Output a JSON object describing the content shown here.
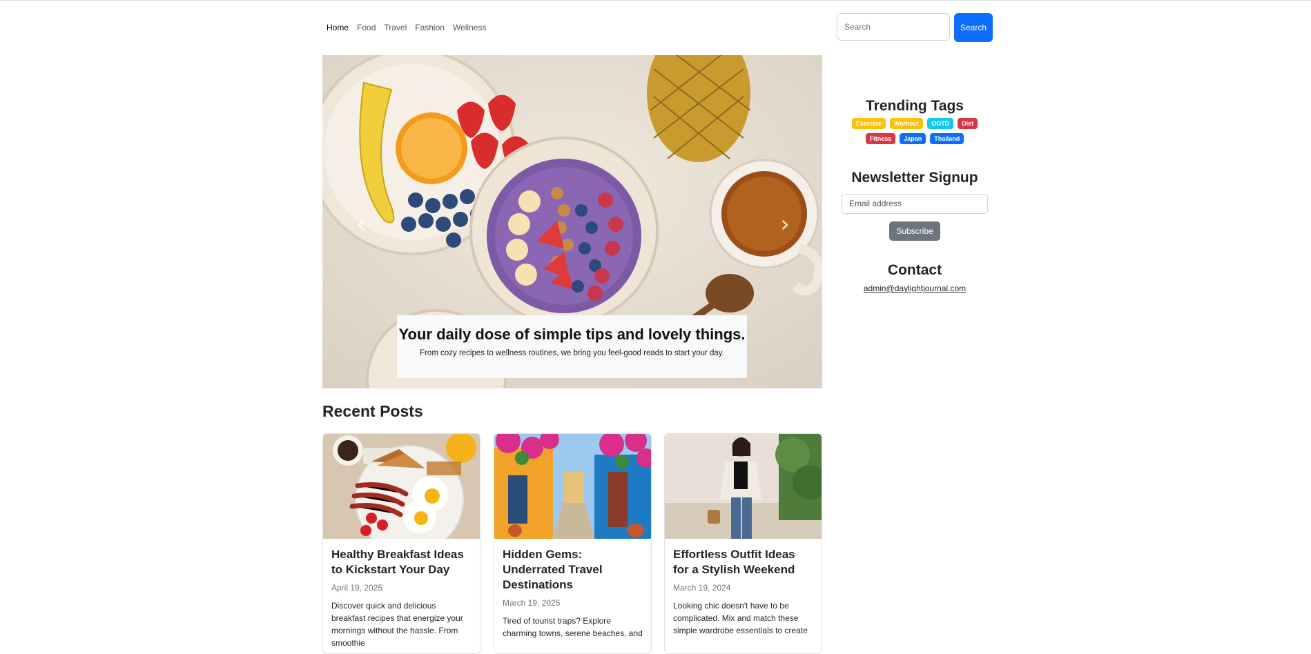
{
  "nav": {
    "links": [
      "Home",
      "Food",
      "Travel",
      "Fashion",
      "Wellness"
    ],
    "search_placeholder": "Search",
    "search_button": "Search"
  },
  "hero": {
    "title": "Your daily dose of simple tips and lovely things.",
    "subtitle": "From cozy recipes to wellness routines, we bring you feel-good reads to start your day."
  },
  "recent": {
    "heading": "Recent Posts",
    "posts": [
      {
        "title": "Healthy Breakfast Ideas to Kickstart Your Day",
        "date": "April 19, 2025",
        "excerpt": "Discover quick and delicious breakfast recipes that energize your mornings without the hassle. From smoothie"
      },
      {
        "title": "Hidden Gems: Underrated Travel Destinations",
        "date": "March 19, 2025",
        "excerpt": "Tired of tourist traps? Explore charming towns, serene beaches, and"
      },
      {
        "title": "Effortless Outfit Ideas for a Stylish Weekend",
        "date": "March 19, 2024",
        "excerpt": "Looking chic doesn't have to be complicated. Mix and match these simple wardrobe essentials to create"
      }
    ]
  },
  "sidebar": {
    "trending_heading": "Trending Tags",
    "tags": [
      {
        "label": "Exercise",
        "color": "#ffc107"
      },
      {
        "label": "Workout",
        "color": "#ffc107"
      },
      {
        "label": "OOTD",
        "color": "#0dcaf0"
      },
      {
        "label": "Diet",
        "color": "#dc3545"
      },
      {
        "label": "Fitness",
        "color": "#dc3545"
      },
      {
        "label": "Japan",
        "color": "#0d6efd"
      },
      {
        "label": "Thailand",
        "color": "#0d6efd"
      }
    ],
    "newsletter_heading": "Newsletter Signup",
    "email_placeholder": "Email address",
    "subscribe_button": "Subscribe",
    "contact_heading": "Contact",
    "contact_email": "admin@daylightjournal.com"
  },
  "icons": {
    "prev": "chevron-left-icon",
    "next": "chevron-right-icon"
  }
}
